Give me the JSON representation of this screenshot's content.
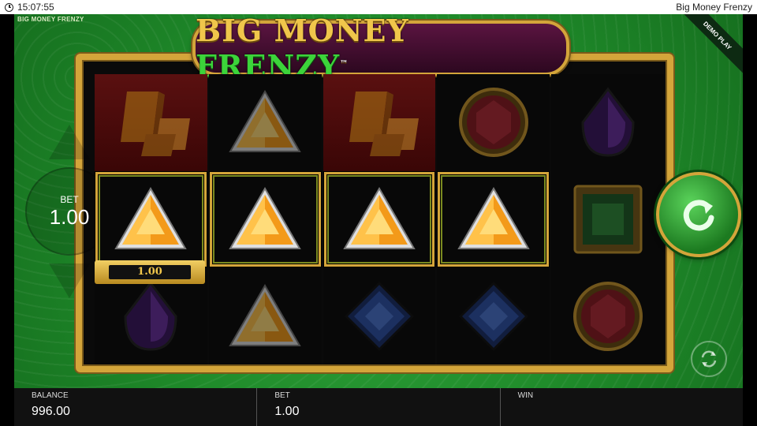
{
  "status_bar": {
    "time": "15:07:55",
    "app_title": "Big Money Frenzy"
  },
  "game": {
    "brand_small": "BIG MONEY FRENZY",
    "logo": {
      "part1": "BIG MONEY",
      "part2": "FRENZY",
      "tm": "™"
    },
    "demo_label": "DEMO PLAY",
    "bet_label": "BET",
    "bet_value": "1.00",
    "win_amount": "1.00"
  },
  "reels": [
    [
      "gold-bars",
      "orange-triangle-gem",
      "purple-drop-gem"
    ],
    [
      "orange-triangle-gem",
      "orange-triangle-gem",
      "orange-triangle-gem"
    ],
    [
      "gold-bars",
      "orange-triangle-gem",
      "blue-diamond-gem"
    ],
    [
      "red-round-gem",
      "orange-triangle-gem",
      "blue-diamond-gem"
    ],
    [
      "purple-drop-gem",
      "green-square-gem",
      "red-round-gem"
    ]
  ],
  "winning_row": 1,
  "winning_reels": [
    0,
    1,
    2,
    3
  ],
  "bottom_bar": {
    "balance_label": "BALANCE",
    "balance_value": "996.00",
    "bet_label": "BET",
    "bet_value": "1.00",
    "win_label": "WIN",
    "win_value": ""
  },
  "colors": {
    "felt": "#1f8a2a",
    "gold": "#d4a53a",
    "logo_green": "#3cd43a",
    "bar": "#111111"
  }
}
